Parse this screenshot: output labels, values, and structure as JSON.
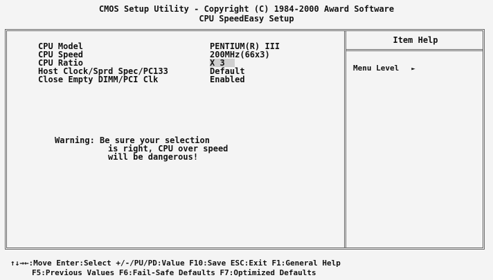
{
  "header": {
    "line1": "CMOS Setup Utility - Copyright (C) 1984-2000 Award Software",
    "line2": "CPU SpeedEasy Setup"
  },
  "settings": [
    {
      "label": "CPU Model",
      "value": "PENTIUM(R) III"
    },
    {
      "label": "CPU Speed",
      "value": "200MHz(66x3)"
    },
    {
      "label": "CPU Ratio",
      "value": "X 3"
    },
    {
      "label": "Host Clock/Sprd Spec/PC133",
      "value": "Default"
    },
    {
      "label": "Close Empty DIMM/PCI Clk",
      "value": "Enabled"
    }
  ],
  "warning": {
    "line1": "Warning: Be sure your selection",
    "line2": "is right, CPU over speed",
    "line3": "will be dangerous!"
  },
  "help": {
    "title": "Item Help",
    "menu_level": "Menu Level",
    "menu_level_arrow": "►"
  },
  "footer": {
    "line1": "↑↓→←:Move  Enter:Select  +/-/PU/PD:Value  F10:Save  ESC:Exit  F1:General Help",
    "line2": "F5:Previous Values     F6:Fail-Safe Defaults     F7:Optimized Defaults"
  },
  "colors": {
    "background": "#f4f4f4",
    "text": "#111111",
    "highlight": "#cfcfcf"
  }
}
